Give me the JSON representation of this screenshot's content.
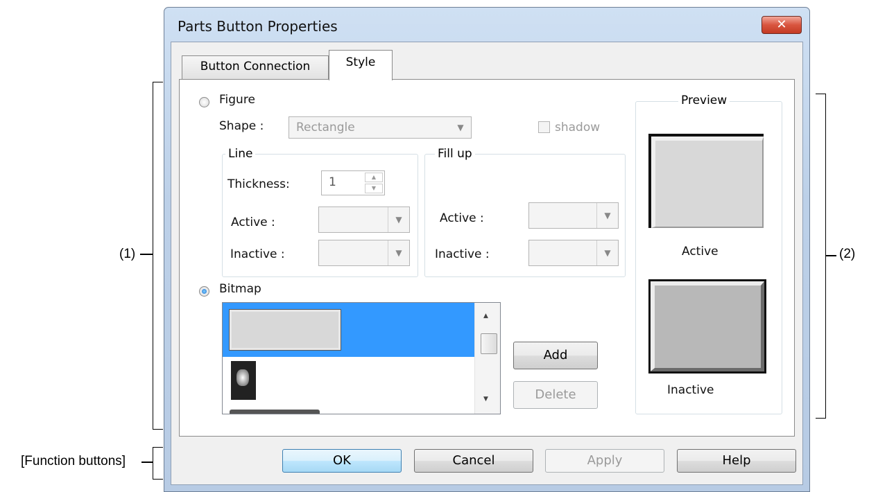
{
  "window": {
    "title": "Parts Button Properties",
    "close_symbol": "✕"
  },
  "tabs": [
    {
      "label": "Button Connection",
      "active": false
    },
    {
      "label": "Style",
      "active": true
    }
  ],
  "figure": {
    "label": "Figure",
    "selected": false,
    "shape_label": "Shape :",
    "shape_value": "Rectangle",
    "shadow_label": "shadow",
    "line": {
      "title": "Line",
      "thickness_label": "Thickness:",
      "thickness_value": "1",
      "active_label": "Active :",
      "inactive_label": "Inactive :"
    },
    "fill": {
      "title": "Fill up",
      "active_label": "Active :",
      "inactive_label": "Inactive :"
    }
  },
  "bitmap": {
    "label": "Bitmap",
    "selected": true,
    "add_label": "Add",
    "delete_label": "Delete"
  },
  "preview": {
    "title": "Preview",
    "active_label": "Active",
    "inactive_label": "Inactive"
  },
  "function_buttons": {
    "ok": "OK",
    "cancel": "Cancel",
    "apply": "Apply",
    "help": "Help"
  },
  "annotations": {
    "area1": "(1)",
    "area2": "(2)",
    "function": "[Function buttons]"
  },
  "colors": {
    "selection": "#3399ff",
    "title_bar": "#bcd0e8",
    "close_button": "#d9553f"
  }
}
